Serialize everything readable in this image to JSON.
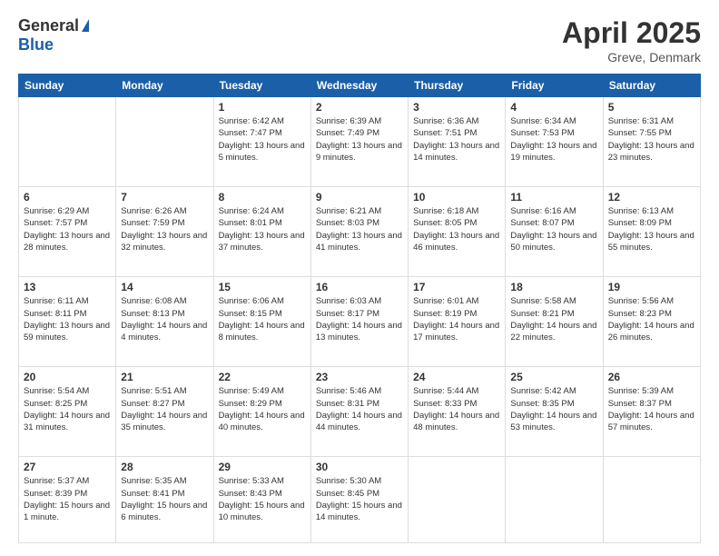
{
  "header": {
    "logo_general": "General",
    "logo_blue": "Blue",
    "month": "April 2025",
    "location": "Greve, Denmark"
  },
  "weekdays": [
    "Sunday",
    "Monday",
    "Tuesday",
    "Wednesday",
    "Thursday",
    "Friday",
    "Saturday"
  ],
  "weeks": [
    [
      {
        "day": "",
        "text": ""
      },
      {
        "day": "",
        "text": ""
      },
      {
        "day": "1",
        "text": "Sunrise: 6:42 AM\nSunset: 7:47 PM\nDaylight: 13 hours and 5 minutes."
      },
      {
        "day": "2",
        "text": "Sunrise: 6:39 AM\nSunset: 7:49 PM\nDaylight: 13 hours and 9 minutes."
      },
      {
        "day": "3",
        "text": "Sunrise: 6:36 AM\nSunset: 7:51 PM\nDaylight: 13 hours and 14 minutes."
      },
      {
        "day": "4",
        "text": "Sunrise: 6:34 AM\nSunset: 7:53 PM\nDaylight: 13 hours and 19 minutes."
      },
      {
        "day": "5",
        "text": "Sunrise: 6:31 AM\nSunset: 7:55 PM\nDaylight: 13 hours and 23 minutes."
      }
    ],
    [
      {
        "day": "6",
        "text": "Sunrise: 6:29 AM\nSunset: 7:57 PM\nDaylight: 13 hours and 28 minutes."
      },
      {
        "day": "7",
        "text": "Sunrise: 6:26 AM\nSunset: 7:59 PM\nDaylight: 13 hours and 32 minutes."
      },
      {
        "day": "8",
        "text": "Sunrise: 6:24 AM\nSunset: 8:01 PM\nDaylight: 13 hours and 37 minutes."
      },
      {
        "day": "9",
        "text": "Sunrise: 6:21 AM\nSunset: 8:03 PM\nDaylight: 13 hours and 41 minutes."
      },
      {
        "day": "10",
        "text": "Sunrise: 6:18 AM\nSunset: 8:05 PM\nDaylight: 13 hours and 46 minutes."
      },
      {
        "day": "11",
        "text": "Sunrise: 6:16 AM\nSunset: 8:07 PM\nDaylight: 13 hours and 50 minutes."
      },
      {
        "day": "12",
        "text": "Sunrise: 6:13 AM\nSunset: 8:09 PM\nDaylight: 13 hours and 55 minutes."
      }
    ],
    [
      {
        "day": "13",
        "text": "Sunrise: 6:11 AM\nSunset: 8:11 PM\nDaylight: 13 hours and 59 minutes."
      },
      {
        "day": "14",
        "text": "Sunrise: 6:08 AM\nSunset: 8:13 PM\nDaylight: 14 hours and 4 minutes."
      },
      {
        "day": "15",
        "text": "Sunrise: 6:06 AM\nSunset: 8:15 PM\nDaylight: 14 hours and 8 minutes."
      },
      {
        "day": "16",
        "text": "Sunrise: 6:03 AM\nSunset: 8:17 PM\nDaylight: 14 hours and 13 minutes."
      },
      {
        "day": "17",
        "text": "Sunrise: 6:01 AM\nSunset: 8:19 PM\nDaylight: 14 hours and 17 minutes."
      },
      {
        "day": "18",
        "text": "Sunrise: 5:58 AM\nSunset: 8:21 PM\nDaylight: 14 hours and 22 minutes."
      },
      {
        "day": "19",
        "text": "Sunrise: 5:56 AM\nSunset: 8:23 PM\nDaylight: 14 hours and 26 minutes."
      }
    ],
    [
      {
        "day": "20",
        "text": "Sunrise: 5:54 AM\nSunset: 8:25 PM\nDaylight: 14 hours and 31 minutes."
      },
      {
        "day": "21",
        "text": "Sunrise: 5:51 AM\nSunset: 8:27 PM\nDaylight: 14 hours and 35 minutes."
      },
      {
        "day": "22",
        "text": "Sunrise: 5:49 AM\nSunset: 8:29 PM\nDaylight: 14 hours and 40 minutes."
      },
      {
        "day": "23",
        "text": "Sunrise: 5:46 AM\nSunset: 8:31 PM\nDaylight: 14 hours and 44 minutes."
      },
      {
        "day": "24",
        "text": "Sunrise: 5:44 AM\nSunset: 8:33 PM\nDaylight: 14 hours and 48 minutes."
      },
      {
        "day": "25",
        "text": "Sunrise: 5:42 AM\nSunset: 8:35 PM\nDaylight: 14 hours and 53 minutes."
      },
      {
        "day": "26",
        "text": "Sunrise: 5:39 AM\nSunset: 8:37 PM\nDaylight: 14 hours and 57 minutes."
      }
    ],
    [
      {
        "day": "27",
        "text": "Sunrise: 5:37 AM\nSunset: 8:39 PM\nDaylight: 15 hours and 1 minute."
      },
      {
        "day": "28",
        "text": "Sunrise: 5:35 AM\nSunset: 8:41 PM\nDaylight: 15 hours and 6 minutes."
      },
      {
        "day": "29",
        "text": "Sunrise: 5:33 AM\nSunset: 8:43 PM\nDaylight: 15 hours and 10 minutes."
      },
      {
        "day": "30",
        "text": "Sunrise: 5:30 AM\nSunset: 8:45 PM\nDaylight: 15 hours and 14 minutes."
      },
      {
        "day": "",
        "text": ""
      },
      {
        "day": "",
        "text": ""
      },
      {
        "day": "",
        "text": ""
      }
    ]
  ]
}
